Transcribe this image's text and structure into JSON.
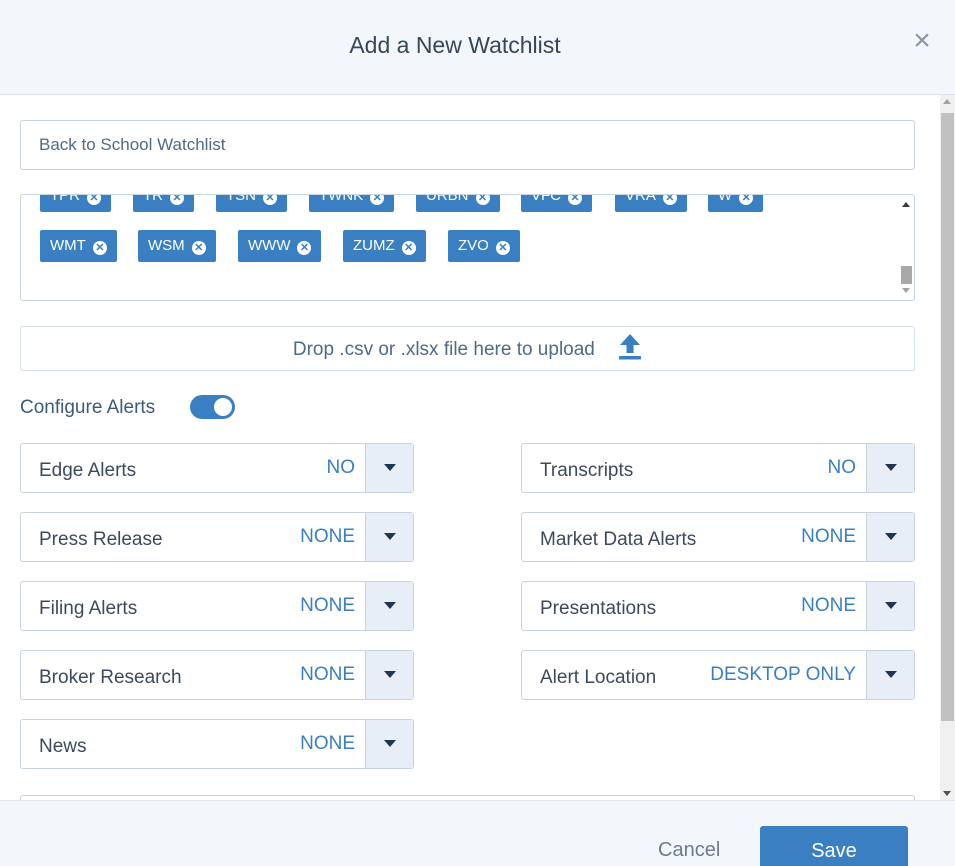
{
  "header": {
    "title": "Add a New Watchlist",
    "close_glyph": "×"
  },
  "form": {
    "name_value": "Back to School Watchlist",
    "tickers": [
      [
        "TPR",
        "TR",
        "TSN",
        "TWNK",
        "URBN",
        "VFC",
        "VRA",
        "W"
      ],
      [
        "WMT",
        "WSM",
        "WWW",
        "ZUMZ",
        "ZVO"
      ]
    ],
    "upload_text": "Drop .csv or .xlsx file here to upload",
    "configure_alerts_label": "Configure Alerts",
    "configure_alerts_on": true
  },
  "alerts": {
    "edge": {
      "label": "Edge Alerts",
      "value": "NO"
    },
    "press_release": {
      "label": "Press Release",
      "value": "NONE"
    },
    "filing": {
      "label": "Filing Alerts",
      "value": "NONE"
    },
    "broker": {
      "label": "Broker Research",
      "value": "NONE"
    },
    "news": {
      "label": "News",
      "value": "NONE"
    },
    "transcripts": {
      "label": "Transcripts",
      "value": "NO"
    },
    "market_data": {
      "label": "Market Data Alerts",
      "value": "NONE"
    },
    "presentations": {
      "label": "Presentations",
      "value": "NONE"
    },
    "location": {
      "label": "Alert Location",
      "value": "DESKTOP ONLY"
    }
  },
  "footer": {
    "cancel_label": "Cancel",
    "save_label": "Save"
  },
  "colors": {
    "accent": "#3a7fc1",
    "header_bg": "#f3f6fb"
  },
  "icons": [
    "close-icon",
    "upload-icon",
    "ticker-remove-icon",
    "chevron-down-icon"
  ]
}
